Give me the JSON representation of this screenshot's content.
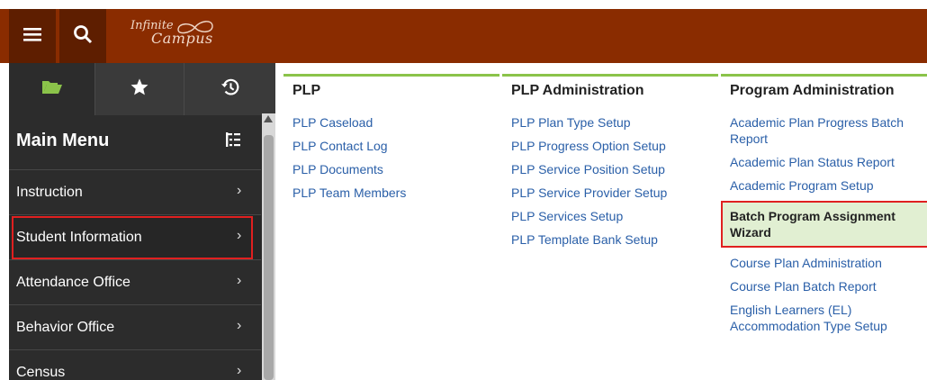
{
  "brand": {
    "line1": "Infinite",
    "line2": "Campus"
  },
  "topbar": {
    "menu_icon": "hamburger-icon",
    "search_icon": "search-icon"
  },
  "sidebar": {
    "tabs": [
      {
        "icon": "folder-icon",
        "active": true
      },
      {
        "icon": "star-icon"
      },
      {
        "icon": "history-icon"
      }
    ],
    "title": "Main Menu",
    "items": [
      {
        "label": "Instruction"
      },
      {
        "label": "Student Information",
        "selected": true
      },
      {
        "label": "Attendance Office"
      },
      {
        "label": "Behavior Office"
      },
      {
        "label": "Census"
      }
    ]
  },
  "columns": [
    {
      "title": "PLP",
      "links": [
        "PLP Caseload",
        "PLP Contact Log",
        "PLP Documents",
        "PLP Team Members"
      ]
    },
    {
      "title": "PLP Administration",
      "links": [
        "PLP Plan Type Setup",
        "PLP Progress Option Setup",
        "PLP Service Position Setup",
        "PLP Service Provider Setup",
        "PLP Services Setup",
        "PLP Template Bank Setup"
      ]
    },
    {
      "title": "Program Administration",
      "links": [
        "Academic Plan Progress Batch Report",
        "Academic Plan Status Report",
        "Academic Program Setup",
        "Batch Program Assignment Wizard",
        "Course Plan Administration",
        "Course Plan Batch Report",
        "English Learners (EL) Accommodation Type Setup"
      ]
    }
  ],
  "colors": {
    "topbar": "#8a2c00",
    "sidebar": "#2c2c2c",
    "link": "#2a5fa8",
    "accent": "#8bc34a",
    "highlight": "#e1efd2",
    "outline": "#e02020"
  }
}
